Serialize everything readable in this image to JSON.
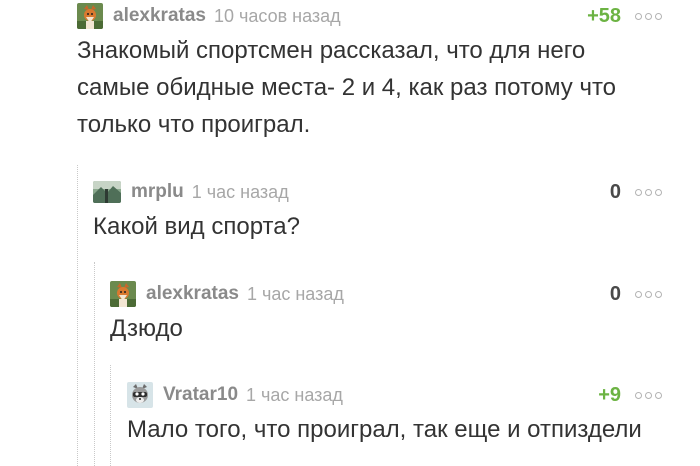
{
  "comments": [
    {
      "author": "alexkratas",
      "time": "10 часов назад",
      "rating": "+58",
      "text": "Знакомый спортсмен рассказал, что для него самые обидные места- 2 и 4, как раз потому что только что проиграл.",
      "avatar_icon": "fox-avatar-icon"
    },
    {
      "author": "mrplu",
      "time": "1 час назад",
      "rating": "0",
      "text": "Какой вид спорта?",
      "avatar_icon": "landscape-avatar-icon"
    },
    {
      "author": "alexkratas",
      "time": "1 час назад",
      "rating": "0",
      "text": "Дзюдо",
      "avatar_icon": "fox-avatar-icon"
    },
    {
      "author": "Vratar10",
      "time": "1 час назад",
      "rating": "+9",
      "text": "Мало того, что проиграл, так еще и отпиздели",
      "avatar_icon": "raccoon-avatar-icon"
    }
  ],
  "colors": {
    "positive_rating": "#6cb343",
    "author": "#8a8a8a",
    "timestamp": "#a7a7a7",
    "text": "#333333"
  }
}
